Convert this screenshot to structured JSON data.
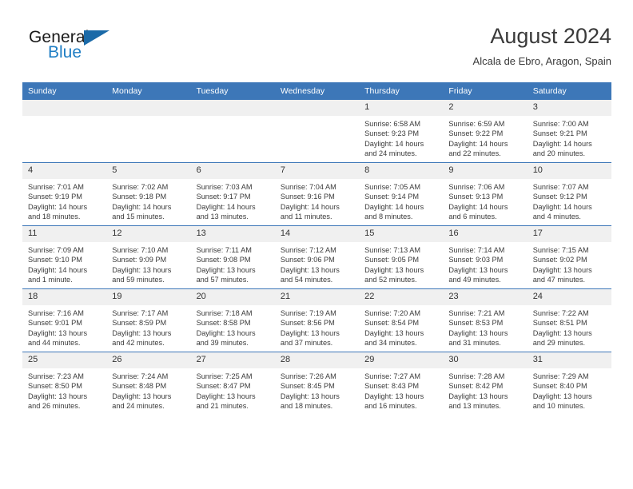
{
  "brand": {
    "name_part1": "General",
    "name_part2": "Blue",
    "triangle_color": "#1b6aa8",
    "blue_color": "#1f7ec4"
  },
  "header": {
    "title": "August 2024",
    "subtitle": "Alcala de Ebro, Aragon, Spain"
  },
  "theme": {
    "header_blue": "#3d77b8",
    "daynum_band": "#f0f0f0",
    "text": "#3b3b3b"
  },
  "weekday_headers": [
    "Sunday",
    "Monday",
    "Tuesday",
    "Wednesday",
    "Thursday",
    "Friday",
    "Saturday"
  ],
  "weeks": [
    [
      {
        "day": "",
        "sunrise": "",
        "sunset": "",
        "daylight_line1": "",
        "daylight_line2": ""
      },
      {
        "day": "",
        "sunrise": "",
        "sunset": "",
        "daylight_line1": "",
        "daylight_line2": ""
      },
      {
        "day": "",
        "sunrise": "",
        "sunset": "",
        "daylight_line1": "",
        "daylight_line2": ""
      },
      {
        "day": "",
        "sunrise": "",
        "sunset": "",
        "daylight_line1": "",
        "daylight_line2": ""
      },
      {
        "day": "1",
        "sunrise": "Sunrise: 6:58 AM",
        "sunset": "Sunset: 9:23 PM",
        "daylight_line1": "Daylight: 14 hours",
        "daylight_line2": "and 24 minutes."
      },
      {
        "day": "2",
        "sunrise": "Sunrise: 6:59 AM",
        "sunset": "Sunset: 9:22 PM",
        "daylight_line1": "Daylight: 14 hours",
        "daylight_line2": "and 22 minutes."
      },
      {
        "day": "3",
        "sunrise": "Sunrise: 7:00 AM",
        "sunset": "Sunset: 9:21 PM",
        "daylight_line1": "Daylight: 14 hours",
        "daylight_line2": "and 20 minutes."
      }
    ],
    [
      {
        "day": "4",
        "sunrise": "Sunrise: 7:01 AM",
        "sunset": "Sunset: 9:19 PM",
        "daylight_line1": "Daylight: 14 hours",
        "daylight_line2": "and 18 minutes."
      },
      {
        "day": "5",
        "sunrise": "Sunrise: 7:02 AM",
        "sunset": "Sunset: 9:18 PM",
        "daylight_line1": "Daylight: 14 hours",
        "daylight_line2": "and 15 minutes."
      },
      {
        "day": "6",
        "sunrise": "Sunrise: 7:03 AM",
        "sunset": "Sunset: 9:17 PM",
        "daylight_line1": "Daylight: 14 hours",
        "daylight_line2": "and 13 minutes."
      },
      {
        "day": "7",
        "sunrise": "Sunrise: 7:04 AM",
        "sunset": "Sunset: 9:16 PM",
        "daylight_line1": "Daylight: 14 hours",
        "daylight_line2": "and 11 minutes."
      },
      {
        "day": "8",
        "sunrise": "Sunrise: 7:05 AM",
        "sunset": "Sunset: 9:14 PM",
        "daylight_line1": "Daylight: 14 hours",
        "daylight_line2": "and 8 minutes."
      },
      {
        "day": "9",
        "sunrise": "Sunrise: 7:06 AM",
        "sunset": "Sunset: 9:13 PM",
        "daylight_line1": "Daylight: 14 hours",
        "daylight_line2": "and 6 minutes."
      },
      {
        "day": "10",
        "sunrise": "Sunrise: 7:07 AM",
        "sunset": "Sunset: 9:12 PM",
        "daylight_line1": "Daylight: 14 hours",
        "daylight_line2": "and 4 minutes."
      }
    ],
    [
      {
        "day": "11",
        "sunrise": "Sunrise: 7:09 AM",
        "sunset": "Sunset: 9:10 PM",
        "daylight_line1": "Daylight: 14 hours",
        "daylight_line2": "and 1 minute."
      },
      {
        "day": "12",
        "sunrise": "Sunrise: 7:10 AM",
        "sunset": "Sunset: 9:09 PM",
        "daylight_line1": "Daylight: 13 hours",
        "daylight_line2": "and 59 minutes."
      },
      {
        "day": "13",
        "sunrise": "Sunrise: 7:11 AM",
        "sunset": "Sunset: 9:08 PM",
        "daylight_line1": "Daylight: 13 hours",
        "daylight_line2": "and 57 minutes."
      },
      {
        "day": "14",
        "sunrise": "Sunrise: 7:12 AM",
        "sunset": "Sunset: 9:06 PM",
        "daylight_line1": "Daylight: 13 hours",
        "daylight_line2": "and 54 minutes."
      },
      {
        "day": "15",
        "sunrise": "Sunrise: 7:13 AM",
        "sunset": "Sunset: 9:05 PM",
        "daylight_line1": "Daylight: 13 hours",
        "daylight_line2": "and 52 minutes."
      },
      {
        "day": "16",
        "sunrise": "Sunrise: 7:14 AM",
        "sunset": "Sunset: 9:03 PM",
        "daylight_line1": "Daylight: 13 hours",
        "daylight_line2": "and 49 minutes."
      },
      {
        "day": "17",
        "sunrise": "Sunrise: 7:15 AM",
        "sunset": "Sunset: 9:02 PM",
        "daylight_line1": "Daylight: 13 hours",
        "daylight_line2": "and 47 minutes."
      }
    ],
    [
      {
        "day": "18",
        "sunrise": "Sunrise: 7:16 AM",
        "sunset": "Sunset: 9:01 PM",
        "daylight_line1": "Daylight: 13 hours",
        "daylight_line2": "and 44 minutes."
      },
      {
        "day": "19",
        "sunrise": "Sunrise: 7:17 AM",
        "sunset": "Sunset: 8:59 PM",
        "daylight_line1": "Daylight: 13 hours",
        "daylight_line2": "and 42 minutes."
      },
      {
        "day": "20",
        "sunrise": "Sunrise: 7:18 AM",
        "sunset": "Sunset: 8:58 PM",
        "daylight_line1": "Daylight: 13 hours",
        "daylight_line2": "and 39 minutes."
      },
      {
        "day": "21",
        "sunrise": "Sunrise: 7:19 AM",
        "sunset": "Sunset: 8:56 PM",
        "daylight_line1": "Daylight: 13 hours",
        "daylight_line2": "and 37 minutes."
      },
      {
        "day": "22",
        "sunrise": "Sunrise: 7:20 AM",
        "sunset": "Sunset: 8:54 PM",
        "daylight_line1": "Daylight: 13 hours",
        "daylight_line2": "and 34 minutes."
      },
      {
        "day": "23",
        "sunrise": "Sunrise: 7:21 AM",
        "sunset": "Sunset: 8:53 PM",
        "daylight_line1": "Daylight: 13 hours",
        "daylight_line2": "and 31 minutes."
      },
      {
        "day": "24",
        "sunrise": "Sunrise: 7:22 AM",
        "sunset": "Sunset: 8:51 PM",
        "daylight_line1": "Daylight: 13 hours",
        "daylight_line2": "and 29 minutes."
      }
    ],
    [
      {
        "day": "25",
        "sunrise": "Sunrise: 7:23 AM",
        "sunset": "Sunset: 8:50 PM",
        "daylight_line1": "Daylight: 13 hours",
        "daylight_line2": "and 26 minutes."
      },
      {
        "day": "26",
        "sunrise": "Sunrise: 7:24 AM",
        "sunset": "Sunset: 8:48 PM",
        "daylight_line1": "Daylight: 13 hours",
        "daylight_line2": "and 24 minutes."
      },
      {
        "day": "27",
        "sunrise": "Sunrise: 7:25 AM",
        "sunset": "Sunset: 8:47 PM",
        "daylight_line1": "Daylight: 13 hours",
        "daylight_line2": "and 21 minutes."
      },
      {
        "day": "28",
        "sunrise": "Sunrise: 7:26 AM",
        "sunset": "Sunset: 8:45 PM",
        "daylight_line1": "Daylight: 13 hours",
        "daylight_line2": "and 18 minutes."
      },
      {
        "day": "29",
        "sunrise": "Sunrise: 7:27 AM",
        "sunset": "Sunset: 8:43 PM",
        "daylight_line1": "Daylight: 13 hours",
        "daylight_line2": "and 16 minutes."
      },
      {
        "day": "30",
        "sunrise": "Sunrise: 7:28 AM",
        "sunset": "Sunset: 8:42 PM",
        "daylight_line1": "Daylight: 13 hours",
        "daylight_line2": "and 13 minutes."
      },
      {
        "day": "31",
        "sunrise": "Sunrise: 7:29 AM",
        "sunset": "Sunset: 8:40 PM",
        "daylight_line1": "Daylight: 13 hours",
        "daylight_line2": "and 10 minutes."
      }
    ]
  ]
}
